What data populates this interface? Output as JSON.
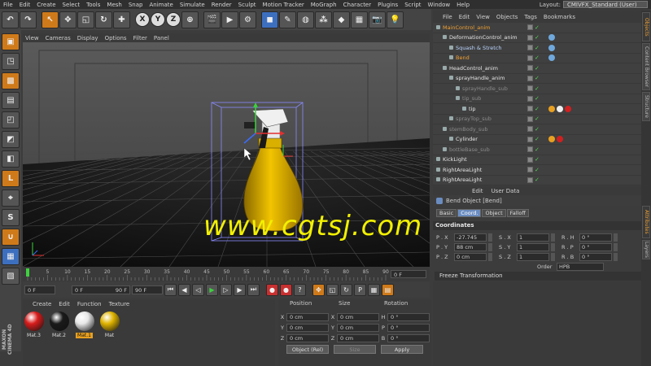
{
  "menubar": {
    "items": [
      "File",
      "Edit",
      "Create",
      "Select",
      "Tools",
      "Mesh",
      "Snap",
      "Animate",
      "Simulate",
      "Render",
      "Sculpt",
      "Motion Tracker",
      "MoGraph",
      "Character",
      "Plugins",
      "Script",
      "Window",
      "Help"
    ],
    "layout_label": "Layout:",
    "layout_value": "CMIVFX_Standard (User)"
  },
  "toolbar": {
    "axis_x": "X",
    "axis_y": "Y",
    "axis_z": "Z"
  },
  "viewport": {
    "menu": [
      "View",
      "Cameras",
      "Display",
      "Options",
      "Filter",
      "Panel"
    ],
    "watermark": "www.cgtsj.com"
  },
  "timeline": {
    "ticks": [
      "0",
      "5",
      "10",
      "15",
      "20",
      "25",
      "30",
      "35",
      "40",
      "45",
      "50",
      "55",
      "60",
      "65",
      "70",
      "75",
      "80",
      "85",
      "90"
    ],
    "frame_indicator": "0 F",
    "start": "0 F",
    "current": "0 F",
    "end_inner": "90 F",
    "end": "90 F"
  },
  "materials": {
    "menu": [
      "Create",
      "Edit",
      "Function",
      "Texture"
    ],
    "items": [
      {
        "name": "Mat.3",
        "color": "#d81c1c"
      },
      {
        "name": "Mat.2",
        "color": "#1a1a1a"
      },
      {
        "name": "Mat.1",
        "color": "#e8e8e8"
      },
      {
        "name": "Mat",
        "color": "#e0b400"
      }
    ],
    "selected": "Mat.1"
  },
  "coords": {
    "headers": {
      "position": "Position",
      "size": "Size",
      "rotation": "Rotation"
    },
    "rows": [
      {
        "ax": "X",
        "pos": "0 cm",
        "sax": "X",
        "size": "0 cm",
        "rax": "H",
        "rot": "0 °"
      },
      {
        "ax": "Y",
        "pos": "0 cm",
        "sax": "Y",
        "size": "0 cm",
        "rax": "P",
        "rot": "0 °"
      },
      {
        "ax": "Z",
        "pos": "0 cm",
        "sax": "Z",
        "size": "0 cm",
        "rax": "B",
        "rot": "0 °"
      }
    ],
    "mode": "Object (Rel)",
    "size_mode": "Size",
    "apply": "Apply"
  },
  "objects": {
    "menu": [
      "File",
      "Edit",
      "View",
      "Objects",
      "Tags",
      "Bookmarks"
    ],
    "items": [
      {
        "name": "MainControl_anim",
        "indent": 0,
        "style": "orange"
      },
      {
        "name": "DeformationControl_anim",
        "indent": 1,
        "style": "white"
      },
      {
        "name": "Squash & Stretch",
        "indent": 2,
        "style": "lblue"
      },
      {
        "name": "Bend",
        "indent": 2,
        "style": "orange"
      },
      {
        "name": "HeadControl_anim",
        "indent": 1,
        "style": "white"
      },
      {
        "name": "sprayHandle_anim",
        "indent": 2,
        "style": "white"
      },
      {
        "name": "sprayHandle_sub",
        "indent": 3,
        "style": "gray"
      },
      {
        "name": "tip_sub",
        "indent": 3,
        "style": "gray"
      },
      {
        "name": "tip",
        "indent": 4,
        "style": "white"
      },
      {
        "name": "sprayTop_sub",
        "indent": 2,
        "style": "gray"
      },
      {
        "name": "stemBody_sub",
        "indent": 1,
        "style": "gray"
      },
      {
        "name": "Cylinder",
        "indent": 2,
        "style": "white"
      },
      {
        "name": "bottleBase_sub",
        "indent": 1,
        "style": "gray"
      },
      {
        "name": "KickLight",
        "indent": 0,
        "style": "white"
      },
      {
        "name": "RightAreaLight",
        "indent": 0,
        "style": "white"
      },
      {
        "name": "RightAreaLight",
        "indent": 0,
        "style": "white"
      }
    ]
  },
  "attributes": {
    "menu": [
      "Edit",
      "User Data"
    ],
    "title": "Bend Object [Bend]",
    "tabs": [
      "Basic",
      "Coord.",
      "Object",
      "Falloff"
    ],
    "active_tab": "Coord.",
    "section": "Coordinates",
    "rows": [
      {
        "a": "P . X",
        "av": "-27.745 cm",
        "b": "S . X",
        "bv": "1",
        "c": "R . H",
        "cv": "0 °"
      },
      {
        "a": "P . Y",
        "av": "88 cm",
        "b": "S . Y",
        "bv": "1",
        "c": "R . P",
        "cv": "0 °"
      },
      {
        "a": "P . Z",
        "av": "0 cm",
        "b": "S . Z",
        "bv": "1",
        "c": "R . B",
        "cv": "0 °"
      }
    ],
    "order_label": "Order",
    "order_value": "HPB",
    "freeze": "Freeze Transformation"
  },
  "sidetabs": [
    "Objects",
    "Content Browser",
    "Structure",
    "Attributes",
    "Layers"
  ]
}
